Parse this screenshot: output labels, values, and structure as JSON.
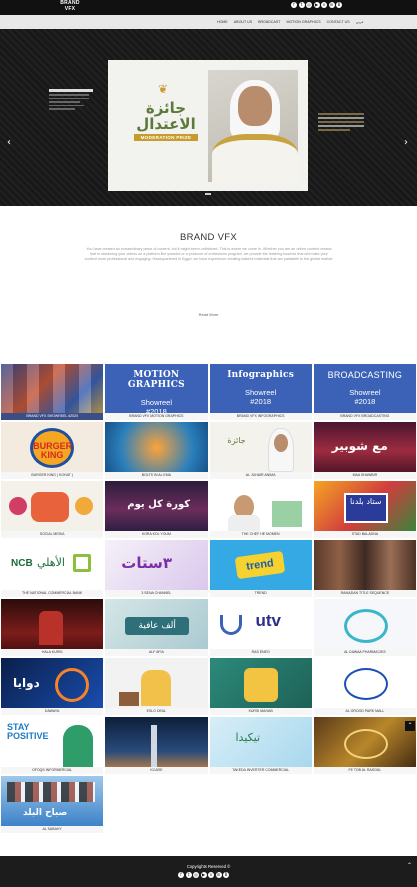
{
  "header": {
    "logo": "BRAND VFX",
    "social_icons": [
      "facebook-icon",
      "twitter-icon",
      "instagram-icon",
      "youtube-icon",
      "vimeo-icon",
      "linkedin-icon",
      "behance-icon"
    ],
    "nav": [
      "HOME",
      "ABOUT US",
      "BROADCAST",
      "MOTION GRAPHICS",
      "CONTACT US",
      "عربي"
    ]
  },
  "hero": {
    "slide_arabic": "جائزة الاعتدال",
    "slide_english": "MODERATION PRIZE"
  },
  "about": {
    "title": "BRAND VFX",
    "text": "You have created an extraordinary piece of content, but it might seem unfinished. This is where we come in. Whether you are an online content creator that is streaming your videos on a platform like youtube or a producer of a television program, we provide the finishing touches that will make your content more professional and engaging. Headquartered in Egypt, we have experience creating tasteful materials that are palatable to the global market.",
    "readmore": "Read More"
  },
  "portfolio": {
    "rows": [
      [
        {
          "caption": "BRAND VFX Showreel #2020",
          "kind": "collage"
        },
        {
          "caption": "BRAND VFX MOTION GRAPHICS",
          "kind": "blue",
          "title": "MOTION GRAPHICS",
          "sub1": "Showreel",
          "sub2": "#2018"
        },
        {
          "caption": "BRAND VFX INFOGRAPHICS",
          "kind": "blue",
          "title": "Infographics",
          "sub1": "Showreel",
          "sub2": "#2018"
        },
        {
          "caption": "BRAND VFX BROADCASTING",
          "kind": "blue",
          "title": "BROADCASTING",
          "sub1": "Showreel",
          "sub2": "#2018"
        }
      ],
      [
        {
          "caption": "Burger King ( Kohat )",
          "kind": "img"
        },
        {
          "caption": "BOLTS IN AL EMA",
          "kind": "img"
        },
        {
          "caption": "Al Juhair Anima",
          "kind": "img"
        },
        {
          "caption": "MAA SHAWBIR",
          "kind": "img"
        }
      ],
      [
        {
          "caption": "SOCIAL MEDIA",
          "kind": "img"
        },
        {
          "caption": "KORA KOL YOUM",
          "kind": "img"
        },
        {
          "caption": "THE CHEF HE MOMEN",
          "kind": "img"
        },
        {
          "caption": "STAD BALADNA",
          "kind": "img"
        }
      ],
      [
        {
          "caption": "THE NATIONAL COMMERCIAL BANK",
          "kind": "img"
        },
        {
          "caption": "3 Sena Channel",
          "kind": "img"
        },
        {
          "caption": "Trend",
          "kind": "img"
        },
        {
          "caption": "Ramadan Title Sequence",
          "kind": "img"
        }
      ],
      [
        {
          "caption": "Hala Kursi",
          "kind": "img"
        },
        {
          "caption": "Alf Afia",
          "kind": "img"
        },
        {
          "caption": "Ras Eneo",
          "kind": "img"
        },
        {
          "caption": "Al Dawaa Pharmacies",
          "kind": "img"
        }
      ],
      [
        {
          "caption": "Dawaya",
          "kind": "img"
        },
        {
          "caption": "Eslo Deal",
          "kind": "img"
        },
        {
          "caption": "Kursi Mahab",
          "kind": "img"
        },
        {
          "caption": "Al Orood Park Mall",
          "kind": "img"
        }
      ],
      [
        {
          "caption": "Ofoqs Informercial",
          "kind": "img"
        },
        {
          "caption": "KCARE",
          "kind": "img"
        },
        {
          "caption": "Takeda Inverter Commercial",
          "kind": "img"
        },
        {
          "caption": "FE TOB AL RASOUL",
          "kind": "img"
        }
      ],
      [
        {
          "caption": "AL SABAHY",
          "kind": "img"
        }
      ]
    ],
    "overlay_texts": {
      "burger_king": "BURGER KING",
      "ncb_en": "NCB",
      "ncb_ar": "الأهلي",
      "utv": "utv",
      "stay_positive": "STAY POSITIVE",
      "trend": "trend",
      "sabah": "صباح البلد"
    }
  },
  "footer": {
    "copyright": "Copyrights Reserved ©"
  },
  "colors": {
    "header_bg": "#111111",
    "blue_tile": "#3b62b7",
    "footer_bg": "#1c1c1c"
  }
}
